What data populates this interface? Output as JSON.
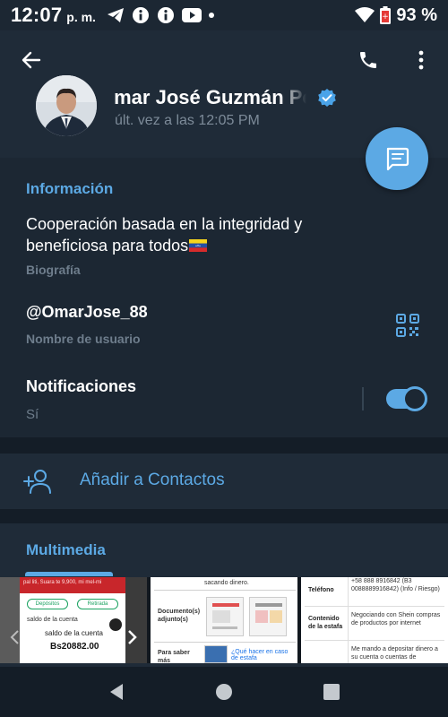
{
  "status_bar": {
    "time": "12:07",
    "ampm": "p. m.",
    "battery": "93 %",
    "icons": [
      "telegram-icon",
      "info-icon",
      "info-icon",
      "youtube-icon",
      "dot-icon",
      "wifi-icon",
      "battery-icon"
    ]
  },
  "header": {
    "back_icon": "arrow-back-icon",
    "call_icon": "phone-icon",
    "more_icon": "more-vert-icon",
    "name": "Omar José Guzmán Pe",
    "last_seen": "últ. vez a las 12:05 PM",
    "verified_icon": "verified-badge-icon"
  },
  "fab": {
    "icon": "message-icon"
  },
  "info": {
    "section_title": "Información",
    "bio": "Cooperación basada en la integridad y beneficiosa para todos",
    "bio_label": "Biografía",
    "username": "@OmarJose_88",
    "username_label": "Nombre de usuario",
    "qr_icon": "qr-code-icon",
    "notifications_title": "Notificaciones",
    "notifications_state": "Sí",
    "notifications_enabled": true
  },
  "add_contact": {
    "label": "Añadir a Contactos",
    "icon": "person-add-icon"
  },
  "media": {
    "title": "Multimedia",
    "thumb1": {
      "banner_text": "pal liti, Suara te 9,900, mi mel-mi",
      "pill_left": "Depósitos",
      "pill_right": "Retirada",
      "left_note": "saldo de la cuenta",
      "saldo_label": "saldo de la cuenta",
      "amount": "Bs20882.00"
    },
    "thumb2": {
      "top_text": "sacando dinero.",
      "doc_label": "Documento(s) adjunto(s)",
      "bottom_label": "Para saber más",
      "link_text": "¿Qué hacer en caso de estafa"
    },
    "thumb3": {
      "phone_value": "+58 888 8916842 (B3 0088889916842) (Info / Riesgo)",
      "phone_label": "Teléfono",
      "content_label": "Contenido de la estafa",
      "content_value": "Negociando con Shein compras de productos por internet",
      "last_value": "Me mando a depositar dinero a su cuenta o cuentas de"
    }
  },
  "colors": {
    "accent": "#5ca9e4",
    "background": "#1c2733",
    "header_bg": "#1f2b38",
    "muted_text": "#6e7d8c",
    "separator": "#141d27"
  }
}
